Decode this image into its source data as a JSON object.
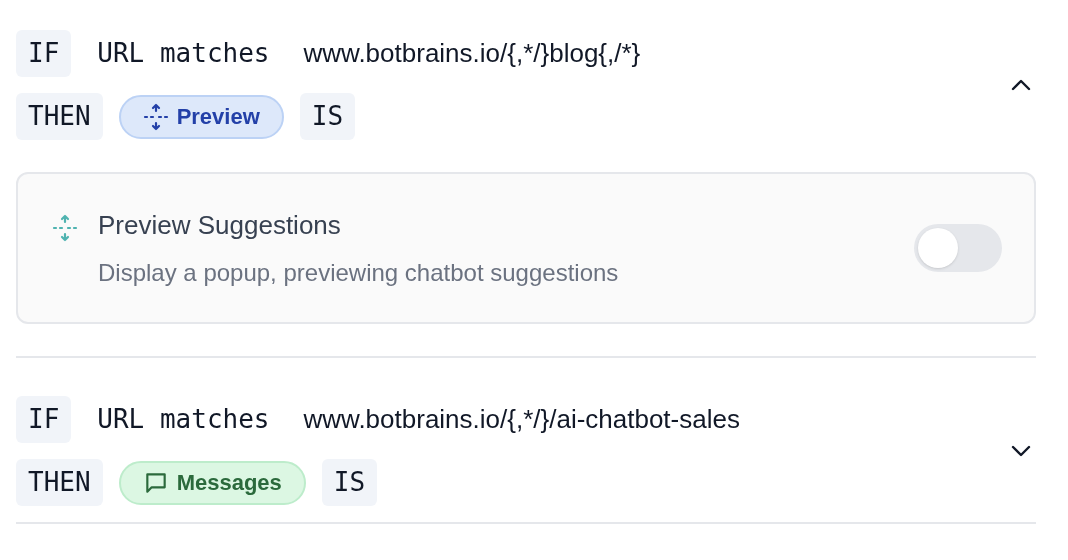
{
  "rules": [
    {
      "if_label": "IF",
      "condition": "URL matches",
      "url": "www.botbrains.io/{,*/}blog{,/*}",
      "then_label": "THEN",
      "action": {
        "kind": "preview",
        "label": "Preview"
      },
      "is_label": "IS",
      "expanded": true,
      "setting": {
        "title": "Preview Suggestions",
        "description": "Display a popup, previewing chatbot suggestions",
        "on": false
      }
    },
    {
      "if_label": "IF",
      "condition": "URL matches",
      "url": "www.botbrains.io/{,*/}/ai-chatbot-sales",
      "then_label": "THEN",
      "action": {
        "kind": "messages",
        "label": "Messages"
      },
      "is_label": "IS",
      "expanded": false
    }
  ]
}
